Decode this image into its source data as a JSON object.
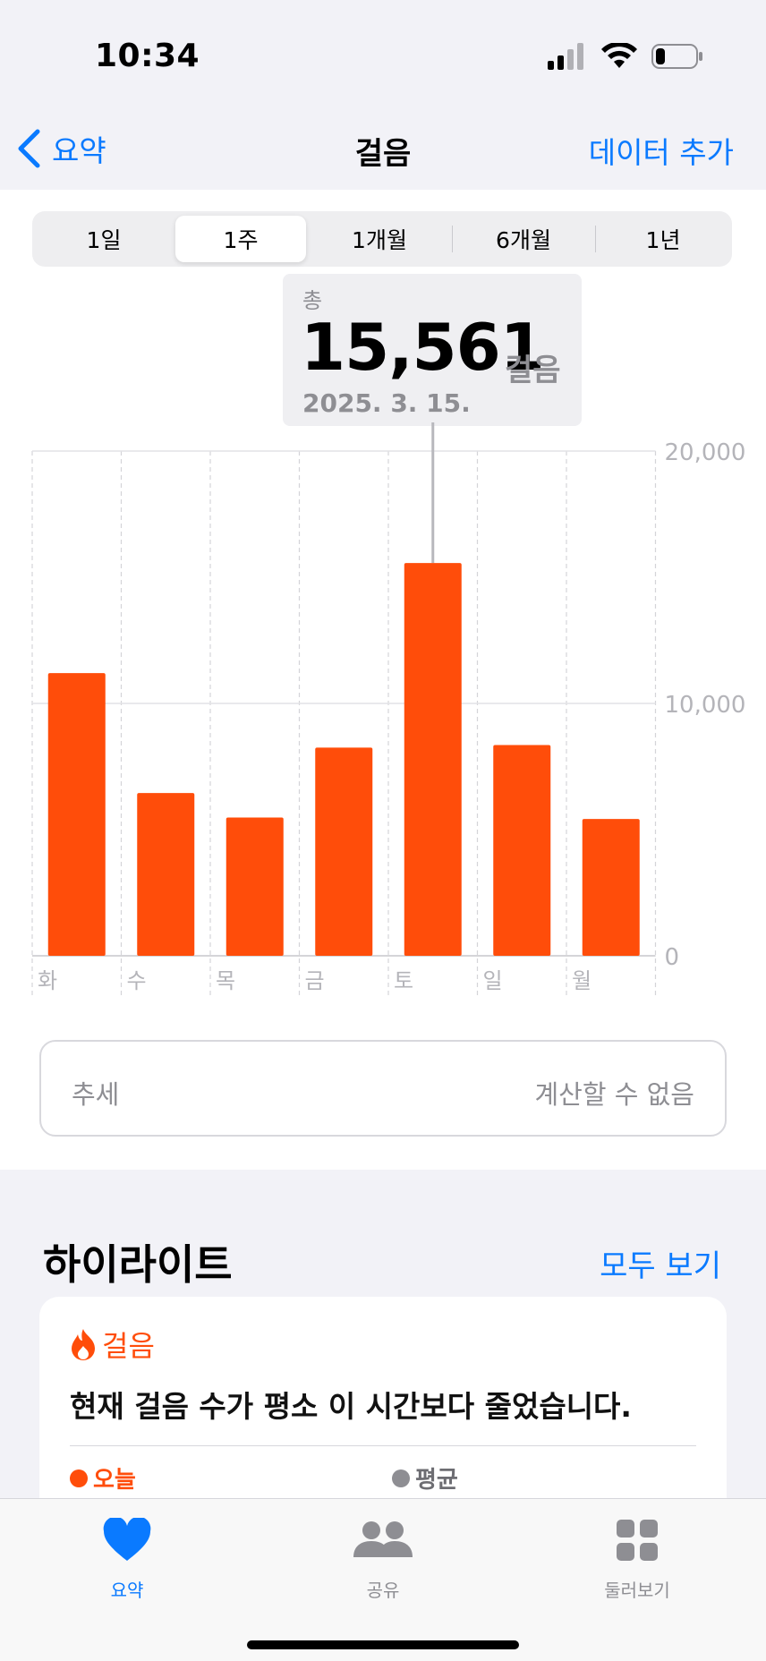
{
  "status_bar": {
    "time": "10:34"
  },
  "nav": {
    "back_label": "요약",
    "title": "걸음",
    "action_label": "데이터 추가"
  },
  "segments": [
    {
      "label": "1일",
      "active": false
    },
    {
      "label": "1주",
      "active": true
    },
    {
      "label": "1개월",
      "active": false
    },
    {
      "label": "6개월",
      "active": false
    },
    {
      "label": "1년",
      "active": false
    }
  ],
  "tooltip": {
    "label": "총",
    "value": "15,561",
    "unit": "걸음",
    "date": "2025. 3. 15."
  },
  "chart_data": {
    "type": "bar",
    "categories": [
      "화",
      "수",
      "목",
      "금",
      "토",
      "일",
      "월"
    ],
    "values": [
      11200,
      6450,
      5480,
      8250,
      15561,
      8350,
      5420
    ],
    "ylim": [
      0,
      20000
    ],
    "yticks": [
      "0",
      "10,000",
      "20,000"
    ],
    "highlight_index": 4,
    "bar_color": "#ff4d0a",
    "grid": true
  },
  "trend": {
    "label": "추세",
    "value": "계산할 수 없음"
  },
  "highlights": {
    "title": "하이라이트",
    "see_all": "모두 보기",
    "card": {
      "category": "걸음",
      "message": "현재 걸음 수가 평소 이 시간보다 줄었습니다.",
      "legend_today": "오늘",
      "legend_average": "평균"
    }
  },
  "tab_bar": {
    "tabs": [
      {
        "label": "요약",
        "icon": "heart-icon",
        "active": true
      },
      {
        "label": "공유",
        "icon": "people-icon",
        "active": false
      },
      {
        "label": "둘러보기",
        "icon": "grid-icon",
        "active": false
      }
    ]
  },
  "colors": {
    "accent": "#0a7aff",
    "activity": "#ff4d0a",
    "secondary_text": "#8e8e93"
  }
}
